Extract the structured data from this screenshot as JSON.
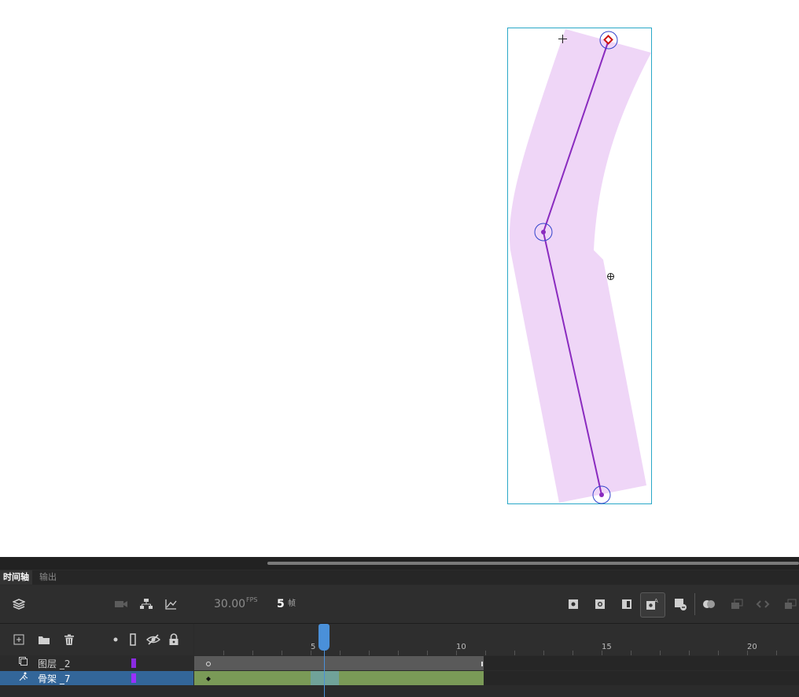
{
  "stage": {
    "shape_fill": "#efd6f7",
    "bone_color": "#8a2bbf",
    "joint_ring_color": "#3344cc",
    "bbox_color": "#2aa8c8"
  },
  "timeline": {
    "tabs": [
      "时间轴",
      "输出"
    ],
    "active_tab": "时间轴",
    "fps_value": "30.00",
    "fps_unit": "FPS",
    "current_frame": "5",
    "frame_unit": "帧",
    "ruler_labels": [
      "5",
      "10",
      "15",
      "20"
    ],
    "layers": [
      {
        "name": "图层 _2",
        "type": "layer-icon",
        "color": "#8a2be2",
        "selected": false
      },
      {
        "name": "骨架 _7",
        "type": "armature-icon",
        "color": "#9b30ff",
        "selected": true
      }
    ],
    "colors": {
      "panel": "#2b2b2b",
      "selected_row": "#336699",
      "pose_span": "#7a9a57",
      "playhead": "#4a90d9"
    }
  }
}
